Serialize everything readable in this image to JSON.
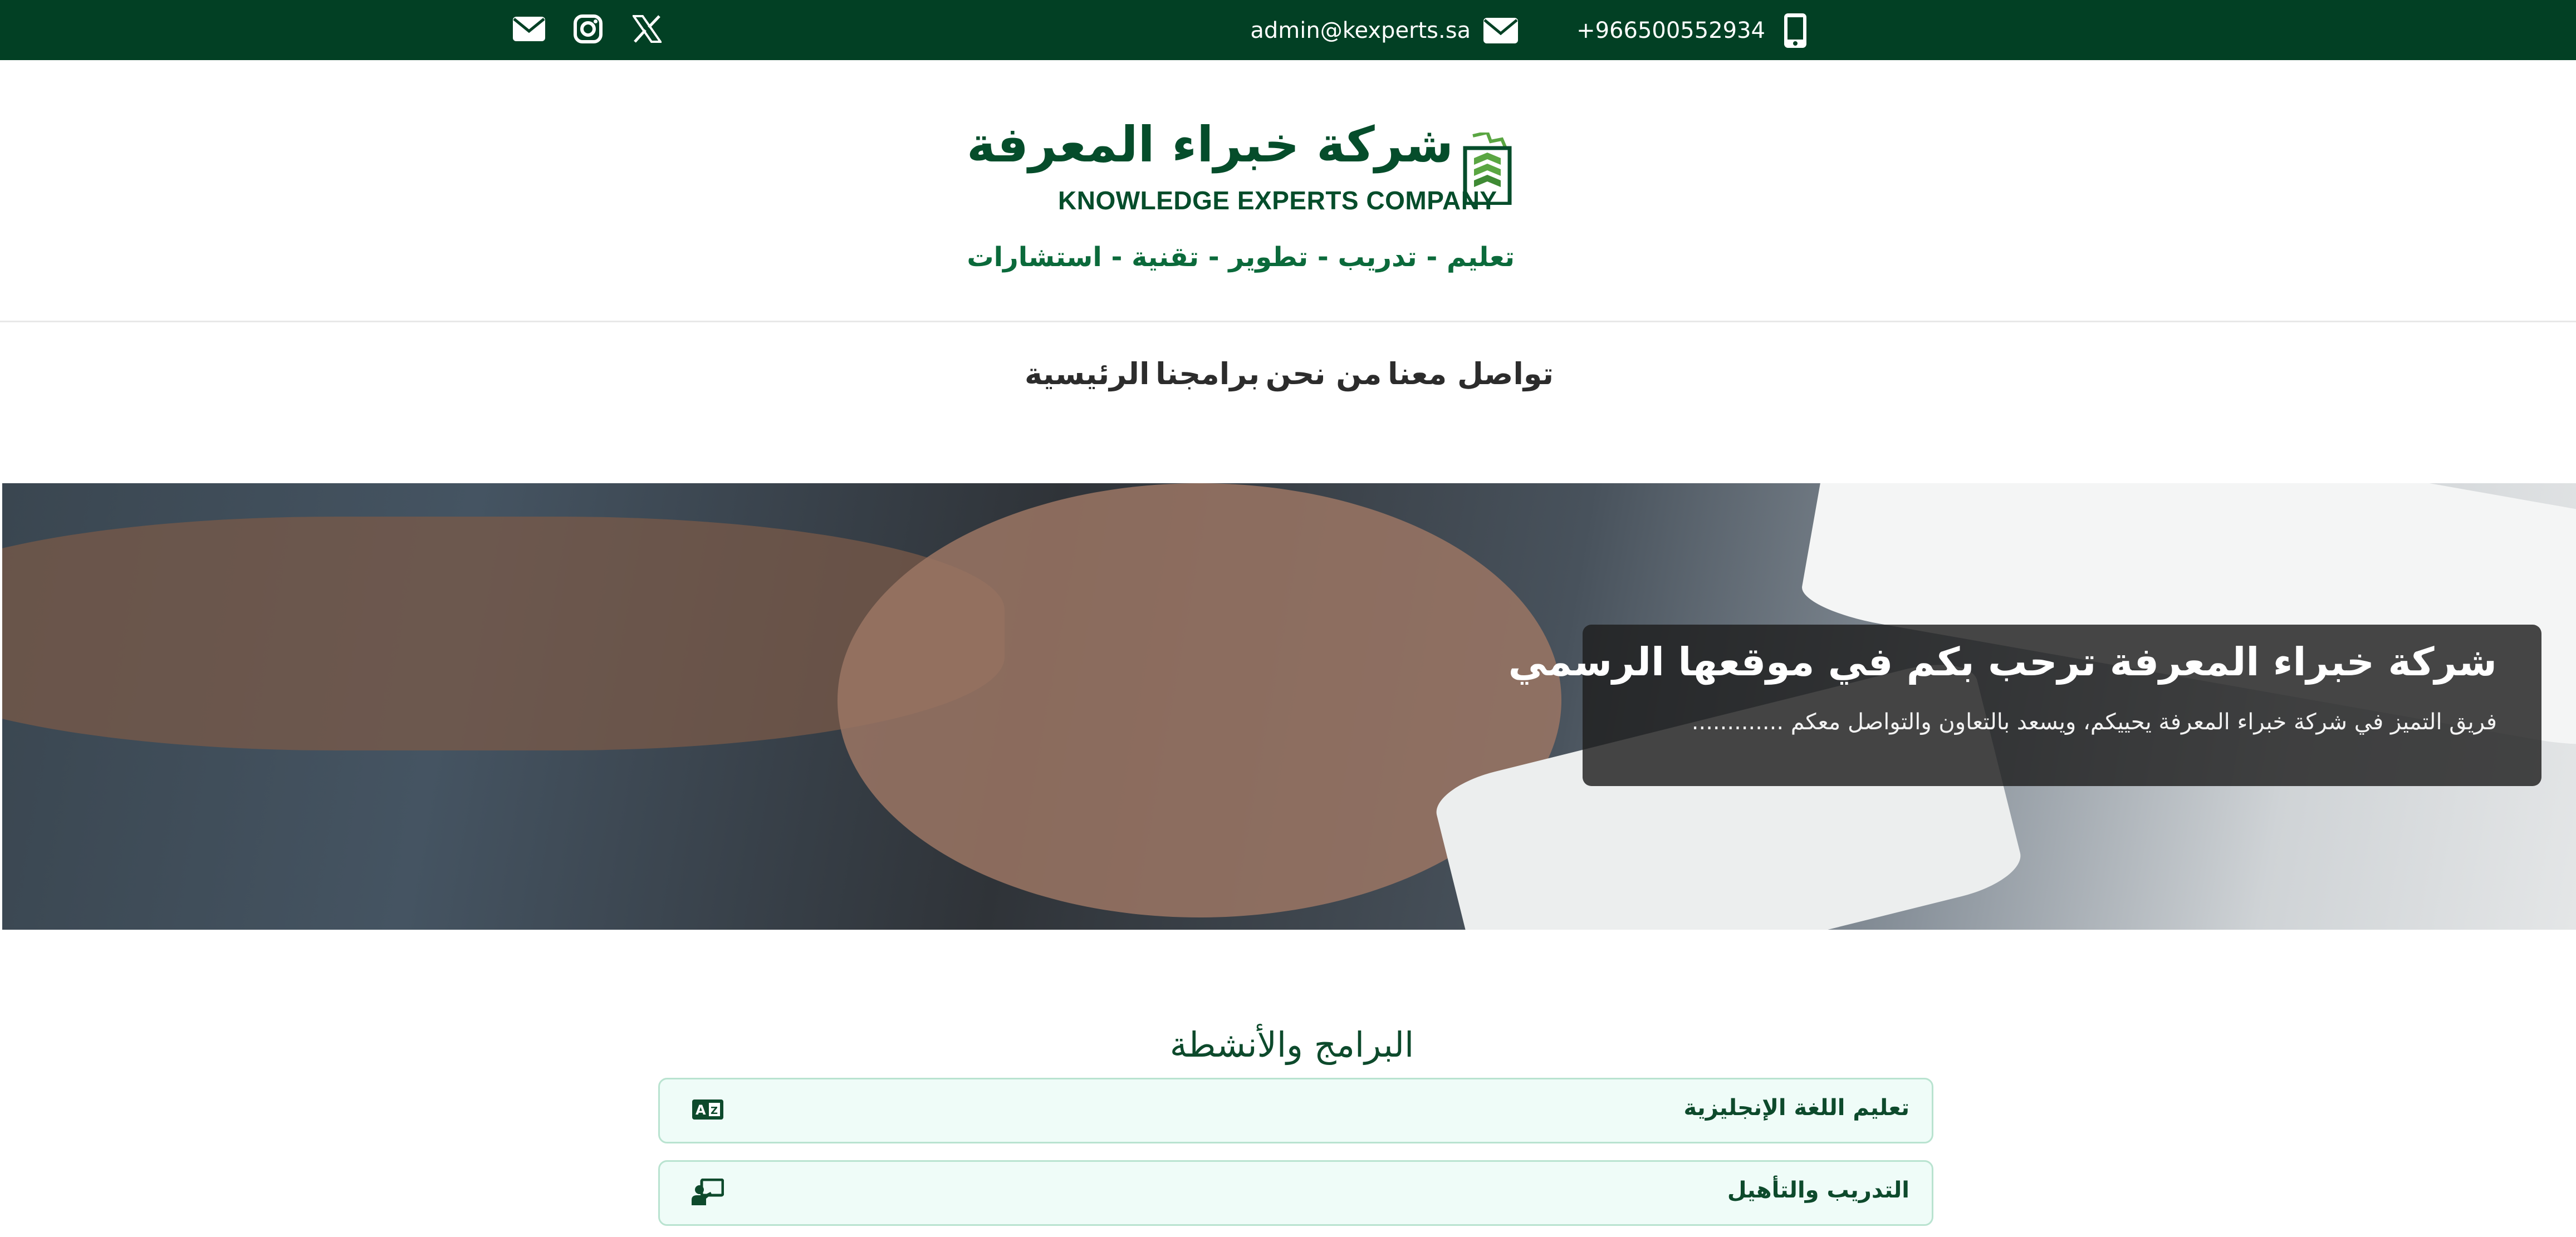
{
  "topbar": {
    "social": [
      {
        "icon": "envelope-icon",
        "name": "email"
      },
      {
        "icon": "instagram-icon",
        "name": "instagram"
      },
      {
        "icon": "x-twitter-icon",
        "name": "x"
      }
    ],
    "phone": "+966500552934",
    "phone_icon": "mobile-phone-icon",
    "email": "admin@kexperts.sa",
    "email_icon": "envelope-icon",
    "background": "#024024"
  },
  "header": {
    "brand_ar": "شركة خبراء المعرفة",
    "brand_en": "KNOWLEDGE EXPERTS COMPANY",
    "tagline": "تعليم - تدريب - تطوير - تقنية - استشارات",
    "logo_icon": "company-logo-icon",
    "brand_color": "#054d2b"
  },
  "nav": {
    "items": [
      "الرئيسية",
      "برامجنا",
      "من نحن",
      "تواصل معنا"
    ]
  },
  "hero": {
    "title": "شركة خبراء المعرفة ترحب بكم في موقعها الرسمي",
    "subtitle": "فريق التميز في شركة خبراء المعرفة يحييكم، ويسعد بالتعاون والتواصل معكم ............."
  },
  "programs": {
    "title": "البرامج والأنشطة",
    "items": [
      {
        "label": "تعليم اللغة الإنجليزية",
        "icon": "language-icon"
      },
      {
        "label": "التدريب والتأهيل",
        "icon": "teacher-board-icon"
      }
    ],
    "accent": "#effcf8"
  }
}
